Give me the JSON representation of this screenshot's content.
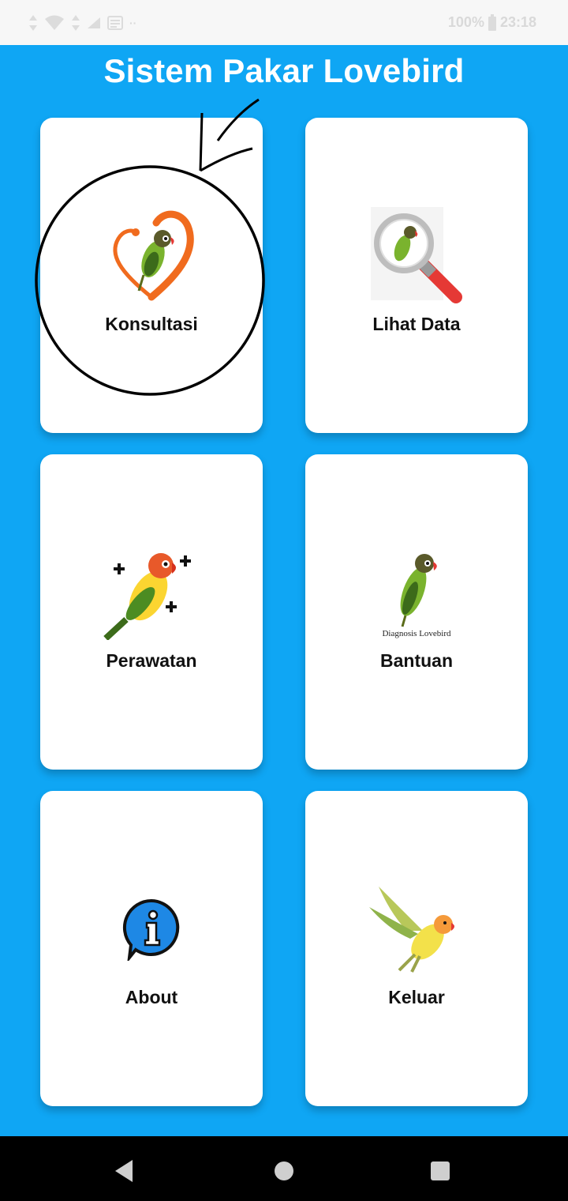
{
  "status_bar": {
    "battery_text": "100%",
    "time": "23:18"
  },
  "app": {
    "title": "Sistem Pakar Lovebird"
  },
  "menu": {
    "konsultasi": {
      "label": "Konsultasi",
      "icon": "heart-lovebird-icon"
    },
    "lihat_data": {
      "label": "Lihat Data",
      "icon": "magnifier-lovebird-icon"
    },
    "perawatan": {
      "label": "Perawatan",
      "icon": "lovebird-plus-icon"
    },
    "bantuan": {
      "label": "Bantuan",
      "icon": "diagnosis-lovebird-icon",
      "image_caption": "Diagnosis Lovebird"
    },
    "about": {
      "label": "About",
      "icon": "info-icon"
    },
    "keluar": {
      "label": "Keluar",
      "icon": "flying-lovebird-icon"
    }
  },
  "colors": {
    "background": "#0fa6f4",
    "card": "#ffffff",
    "accent_orange": "#f06b1e",
    "info_blue": "#1e88e5",
    "nav_bar": "#000000"
  }
}
